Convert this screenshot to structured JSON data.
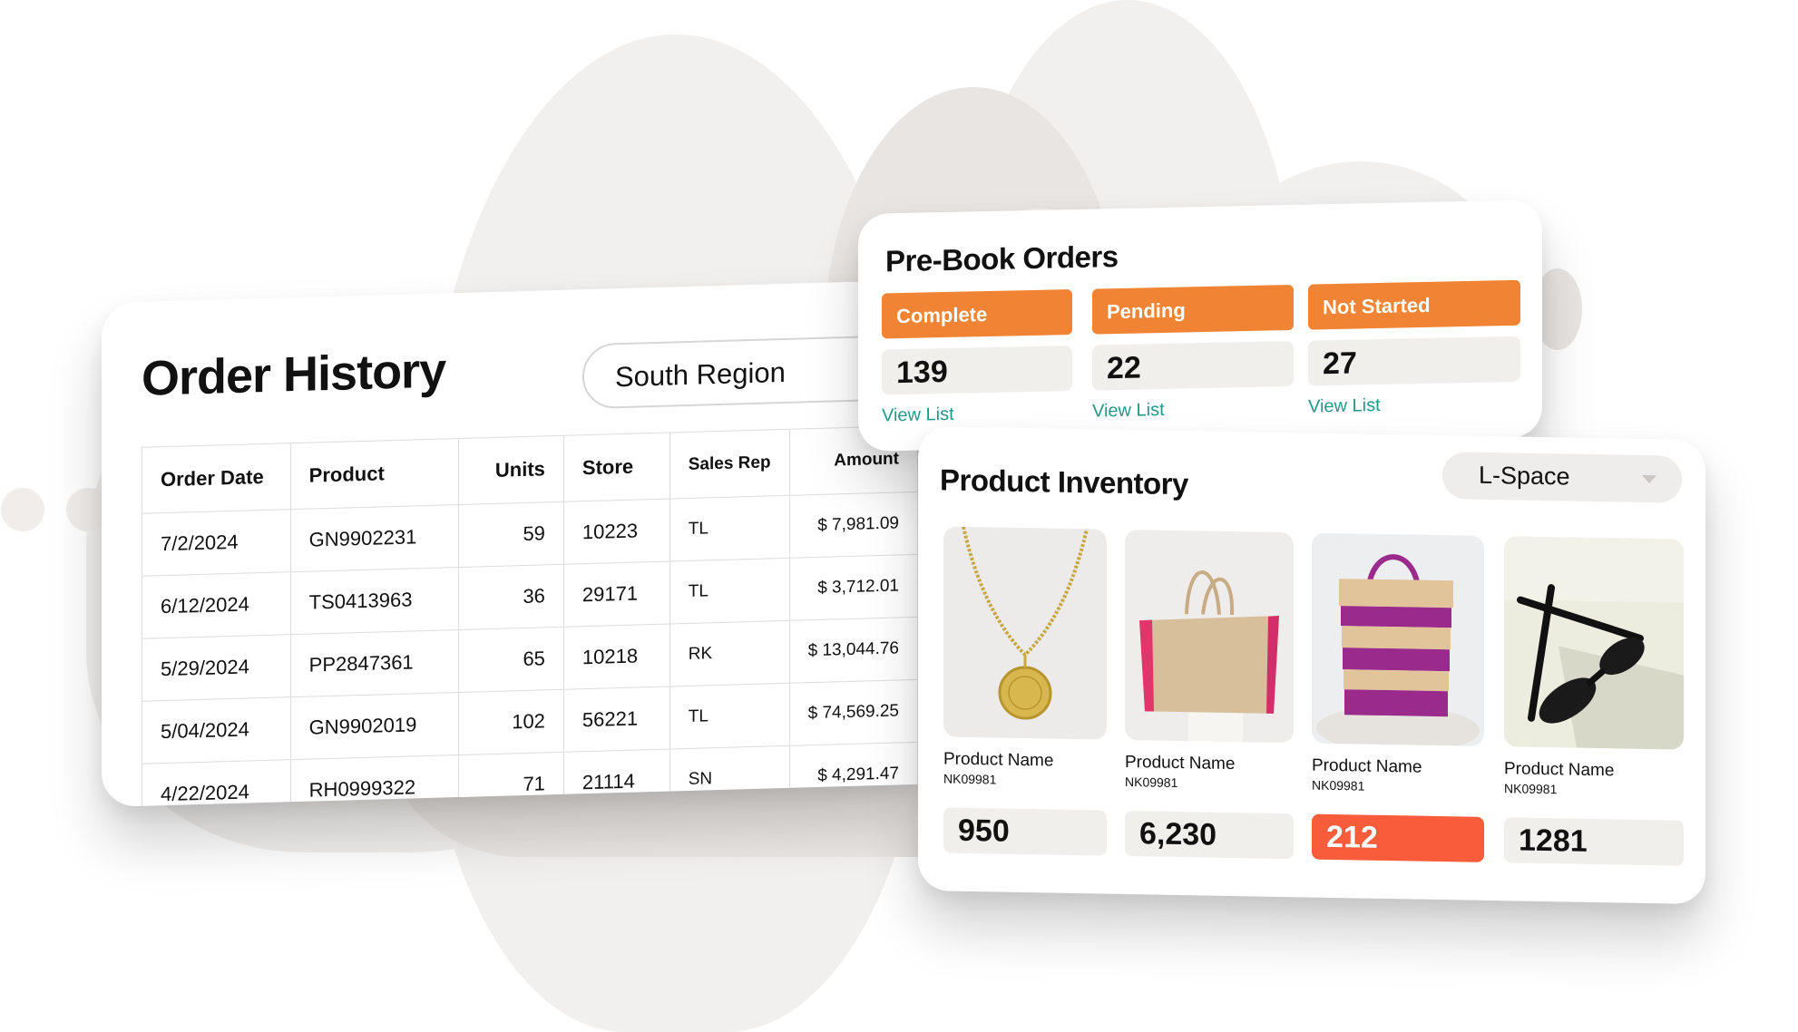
{
  "order_history": {
    "title": "Order History",
    "region_filter": "South Region",
    "columns": [
      "Order Date",
      "Product",
      "Units",
      "Store",
      "Sales Rep",
      "Amount"
    ],
    "rows": [
      [
        "7/2/2024",
        "GN9902231",
        "59",
        "10223",
        "TL",
        "$ 7,981.09"
      ],
      [
        "6/12/2024",
        "TS0413963",
        "36",
        "29171",
        "TL",
        "$ 3,712.01"
      ],
      [
        "5/29/2024",
        "PP2847361",
        "65",
        "10218",
        "RK",
        "$ 13,044.76"
      ],
      [
        "5/04/2024",
        "GN9902019",
        "102",
        "56221",
        "TL",
        "$ 74,569.25"
      ],
      [
        "4/22/2024",
        "RH0999322",
        "71",
        "21114",
        "SN",
        "$ 4,291.47"
      ]
    ]
  },
  "prebook": {
    "title": "Pre-Book Orders",
    "statuses": [
      {
        "label": "Complete",
        "count": "139",
        "link": "View List"
      },
      {
        "label": "Pending",
        "count": "22",
        "link": "View List"
      },
      {
        "label": "Not Started",
        "count": "27",
        "link": "View List"
      }
    ]
  },
  "inventory": {
    "title": "Product Inventory",
    "store_filter": "L-Space",
    "products": [
      {
        "image": "gold-necklace-image",
        "name": "Product Name",
        "sku": "NK09981",
        "qty": "950",
        "alert": false
      },
      {
        "image": "straw-tote-image",
        "name": "Product Name",
        "sku": "NK09981",
        "qty": "6,230",
        "alert": false
      },
      {
        "image": "striped-basket-bag-image",
        "name": "Product Name",
        "sku": "NK09981",
        "qty": "212",
        "alert": true
      },
      {
        "image": "sunglasses-image",
        "name": "Product Name",
        "sku": "NK09981",
        "qty": "1281",
        "alert": false
      }
    ]
  },
  "colors": {
    "status_orange": "#f08434",
    "alert_red": "#f85c3a",
    "link_teal": "#1f9a8a",
    "value_bg": "#f1efec"
  }
}
